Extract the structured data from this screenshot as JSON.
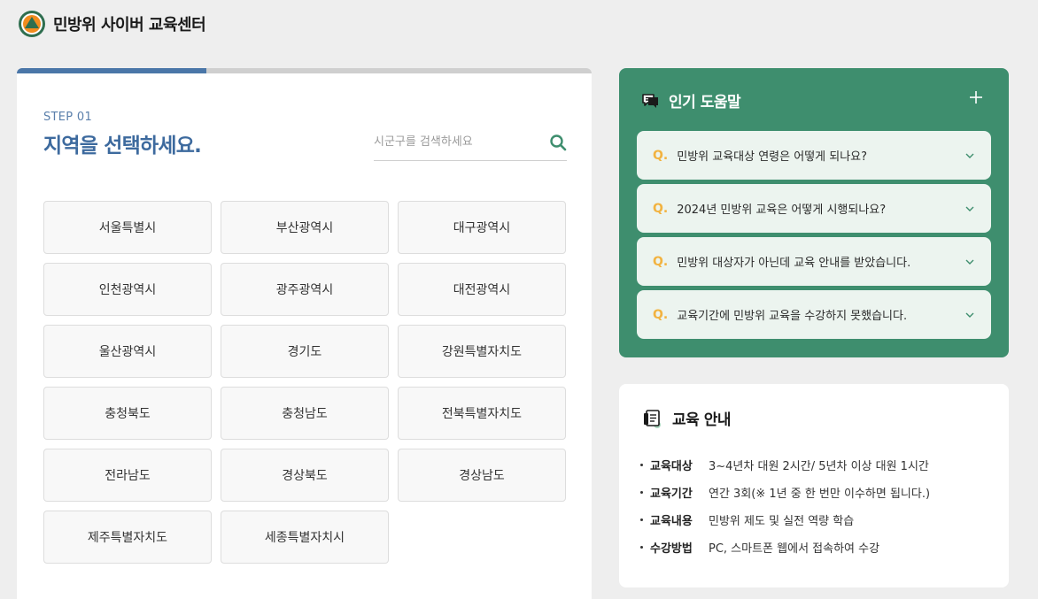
{
  "header": {
    "site_title": "민방위 사이버 교육센터",
    "logo_icon": "civil-defense-logo"
  },
  "region_select": {
    "step_label": "STEP 01",
    "heading": "지역을 선택하세요.",
    "progress_fraction": 0.33,
    "search": {
      "placeholder": "시군구를 검색하세요",
      "value": ""
    },
    "regions": [
      "서울특별시",
      "부산광역시",
      "대구광역시",
      "인천광역시",
      "광주광역시",
      "대전광역시",
      "울산광역시",
      "경기도",
      "강원특별자치도",
      "충청북도",
      "충청남도",
      "전북특별자치도",
      "전라남도",
      "경상북도",
      "경상남도",
      "제주특별자치도",
      "세종특별자치시"
    ]
  },
  "faq": {
    "title": "인기 도움말",
    "q_prefix": "Q.",
    "items": [
      "민방위 교육대상 연령은 어떻게 되나요?",
      "2024년 민방위 교육은 어떻게 시행되나요?",
      "민방위 대상자가 아닌데 교육 안내를 받았습니다.",
      "교육기간에 민방위 교육을 수강하지 못했습니다."
    ]
  },
  "edu_info": {
    "title": "교육 안내",
    "rows": [
      {
        "label": "교육대상",
        "value": "3~4년차 대원 2시간/ 5년차 이상 대원 1시간"
      },
      {
        "label": "교육기간",
        "value": "연간 3회(※ 1년 중 한 번만 이수하면 됩니다.)"
      },
      {
        "label": "교육내용",
        "value": "민방위 제도 및 실전 역량 학습"
      },
      {
        "label": "수강방법",
        "value": "PC, 스마트폰 웹에서 접속하여 수강"
      }
    ]
  },
  "colors": {
    "primary_blue": "#3d6a9e",
    "faq_green": "#3e8e6e",
    "q_yellow": "#f2b341"
  }
}
